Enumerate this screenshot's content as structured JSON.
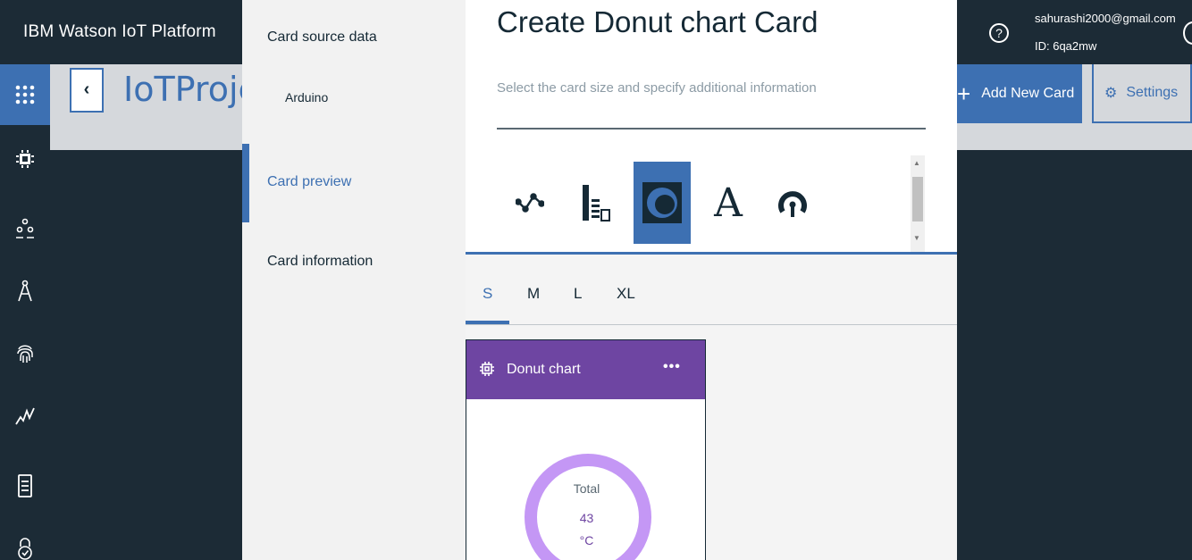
{
  "header": {
    "brand": "IBM Watson IoT Platform",
    "help_icon": "?",
    "user_email": "sahurashi2000@gmail.com",
    "user_id": "ID: 6qa2mw"
  },
  "leftnav": {
    "items": [
      "apps-icon",
      "chip-icon",
      "members-icon",
      "rules-icon",
      "security-fingerprint-icon",
      "analytics-icon",
      "device-icon",
      "lock-icon"
    ]
  },
  "project": {
    "back_label": "‹",
    "title": "IoTProjec",
    "add_card_plus": "+",
    "add_card_label": "Add New Card",
    "settings_label": "Settings"
  },
  "modal_nav": {
    "card_source_data": "Card source data",
    "source_value": "Arduino",
    "card_preview": "Card preview",
    "card_information": "Card information"
  },
  "modal": {
    "title": "Create Donut chart Card",
    "subtitle": "Select the card size and specify additional information",
    "type_icons": [
      "line-chart-icon",
      "bar-chart-icon",
      "donut-chart-icon",
      "text-icon",
      "gauge-icon"
    ],
    "selected_type": "donut-chart-icon",
    "type_text_glyph": "A"
  },
  "sizes": {
    "tabs": [
      "S",
      "M",
      "L",
      "XL"
    ],
    "selected": "S"
  },
  "card": {
    "title": "Donut chart",
    "menu": "•••",
    "donut_label": "Total",
    "donut_value": "43",
    "donut_unit": "°C",
    "donut_color": "#c497f5",
    "header_color": "#6e45a2"
  }
}
